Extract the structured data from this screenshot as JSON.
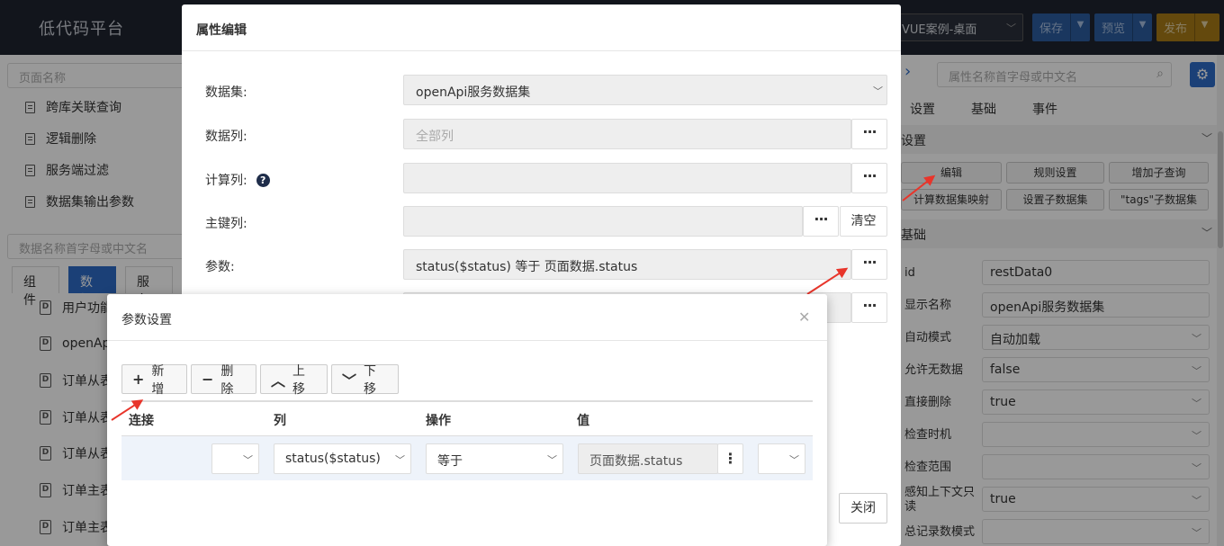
{
  "app": {
    "title": "低代码平台"
  },
  "header": {
    "page_select": "VUE案例-桌面",
    "save_label": "保存",
    "preview_label": "预览",
    "publish_label": "发布"
  },
  "left_panel": {
    "search_placeholder": "页面名称",
    "pages": [
      "跨库关联查询",
      "逻辑删除",
      "服务端过滤",
      "数据集输出参数"
    ],
    "ds_search_placeholder": "数据名称首字母或中文名",
    "tabs": [
      "组件",
      "数据",
      "服务"
    ],
    "datasets": [
      "用户功能",
      "openAp",
      "订单从表",
      "订单从表",
      "订单从表",
      "订单主表",
      "订单主表"
    ]
  },
  "right_panel": {
    "search_placeholder": "属性名称首字母或中文名",
    "tabs": [
      "设置",
      "基础",
      "事件"
    ],
    "settings_section": "设置",
    "buttons": [
      "编辑",
      "规则设置",
      "增加子查询",
      "计算数据集映射",
      "设置子数据集",
      "\"tags\"子数据集"
    ],
    "basic_section": "基础",
    "props": [
      {
        "label": "id",
        "value": "restData0",
        "dropdown": false
      },
      {
        "label": "显示名称",
        "value": "openApi服务数据集",
        "dropdown": false
      },
      {
        "label": "自动模式",
        "value": "自动加载",
        "dropdown": true
      },
      {
        "label": "允许无数据",
        "value": "false",
        "dropdown": true
      },
      {
        "label": "直接删除",
        "value": "true",
        "dropdown": true
      },
      {
        "label": "检查时机",
        "value": "",
        "dropdown": true
      },
      {
        "label": "检查范围",
        "value": "",
        "dropdown": true
      },
      {
        "label": "感知上下文只读",
        "value": "true",
        "dropdown": true
      },
      {
        "label": "总记录数模式",
        "value": "",
        "dropdown": true
      }
    ]
  },
  "property_modal": {
    "title": "属性编辑",
    "dataset_label": "数据集:",
    "dataset_value": "openApi服务数据集",
    "columns_label": "数据列:",
    "columns_placeholder": "全部列",
    "calc_label": "计算列:",
    "help_glyph": "?",
    "pk_label": "主键列:",
    "clear_label": "清空",
    "params_label": "参数:",
    "params_value": "status($status) 等于 页面数据.status",
    "close_label": "关闭"
  },
  "param_modal": {
    "title": "参数设置",
    "add_label": "新增",
    "delete_label": "删除",
    "up_label": "上移",
    "down_label": "下移",
    "columns": [
      "连接",
      "列",
      "操作",
      "值"
    ],
    "row": {
      "connect": "",
      "column": "status($status)",
      "operator": "等于",
      "value": "页面数据.status",
      "tail": ""
    }
  },
  "colors": {
    "topbar": "#1f2430",
    "accent": "#2e6bc6",
    "publish": "#e0a21f",
    "arrow": "#e8352b"
  }
}
